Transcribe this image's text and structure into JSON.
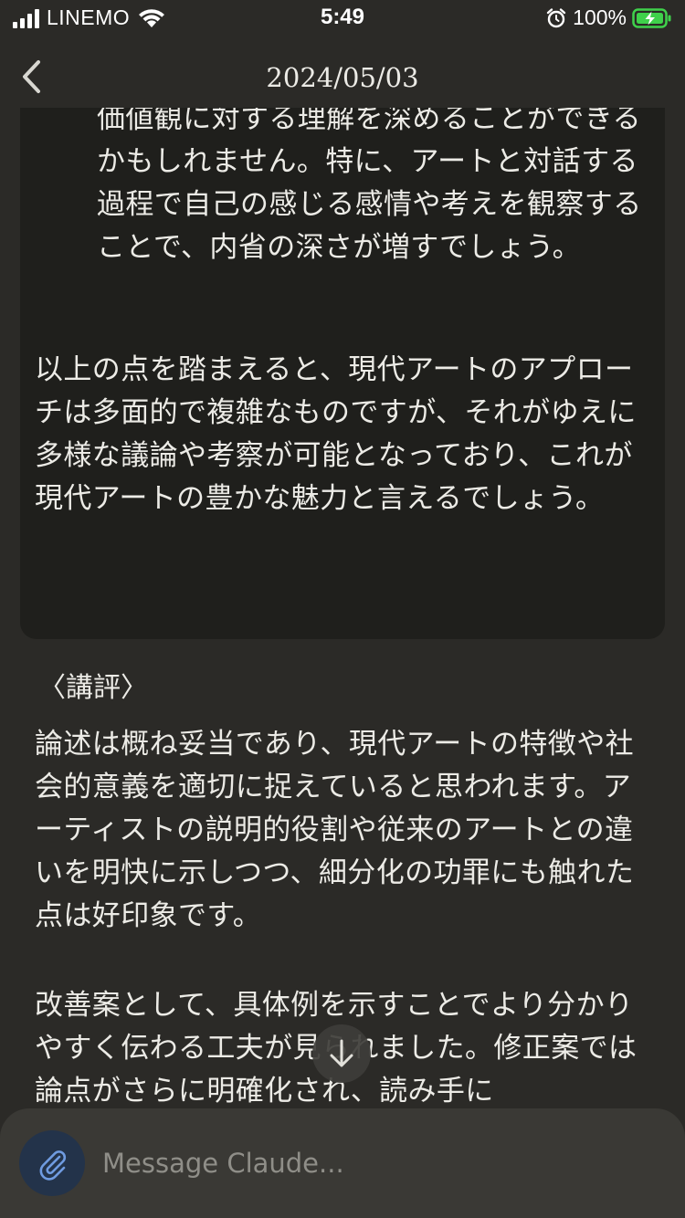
{
  "status_bar": {
    "carrier": "LINEMO",
    "time": "5:49",
    "battery": "100%"
  },
  "header": {
    "title": "2024/05/03"
  },
  "message": {
    "bullet_text": "この分析を通じて、あなたが自己の認知や価値観に対する理解を深めることができるかもしれません。特に、アートと対話する過程で自己の感じる感情や考えを観察することで、内省の深さが増すでしょう。",
    "summary": "以上の点を踏まえると、現代アートのアプローチは多面的で複雑なものですが、それがゆえに多様な議論や考察が可能となっており、これが現代アートの豊かな魅力と言えるでしょう。"
  },
  "review": {
    "heading": "〈講評〉",
    "paragraph1": "論述は概ね妥当であり、現代アートの特徴や社会的意義を適切に捉えていると思われます。アーティストの説明的役割や従来のアートとの違いを明快に示しつつ、細分化の功罪にも触れた点は好印象です。",
    "paragraph2": "改善案として、具体例を示すことでより分かりやすく伝わる工夫が見られました。修正案では論点がさらに明確化され、読み手に"
  },
  "composer": {
    "placeholder": "Message Claude..."
  },
  "icons": {
    "back": "chevron-left-icon",
    "scroll": "arrow-down-icon",
    "attach": "paperclip-icon",
    "wifi": "wifi-icon",
    "alarm": "alarm-icon",
    "battery": "battery-charging-icon"
  },
  "colors": {
    "background": "#2b2a27",
    "card": "#1f1f1c",
    "composer": "#3a3935",
    "attach_button": "#23334a",
    "battery_green": "#3fd14b"
  }
}
